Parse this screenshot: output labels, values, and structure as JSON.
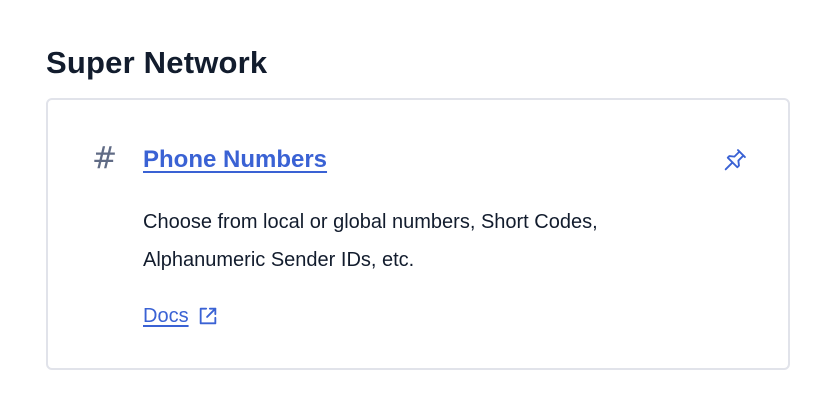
{
  "section": {
    "title": "Super Network"
  },
  "card": {
    "icon": "hash-icon",
    "title": "Phone Numbers",
    "description": "Choose from local or global numbers, Short Codes, Alphanumeric Sender IDs, etc.",
    "docs_label": "Docs",
    "pin_icon": "pin-icon",
    "external_icon": "external-link-icon",
    "link_color": "#3a62d4"
  }
}
